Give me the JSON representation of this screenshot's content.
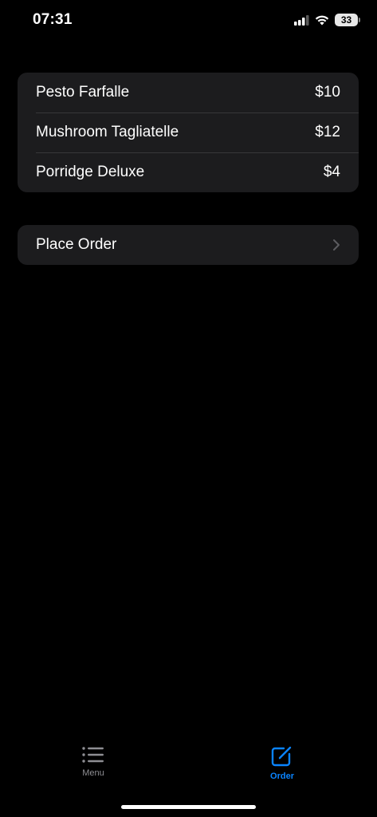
{
  "status_bar": {
    "time": "07:31",
    "battery": "33",
    "icons": [
      "cellular-signal-icon",
      "wifi-icon",
      "battery-icon"
    ]
  },
  "menu": {
    "items": [
      {
        "name": "Pesto Farfalle",
        "price": "$10"
      },
      {
        "name": "Mushroom Tagliatelle",
        "price": "$12"
      },
      {
        "name": "Porridge Deluxe",
        "price": "$4"
      }
    ]
  },
  "actions": {
    "place_order": "Place Order"
  },
  "tab_bar": {
    "tabs": [
      {
        "label": "Menu",
        "icon": "list-icon",
        "selected": false
      },
      {
        "label": "Order",
        "icon": "compose-icon",
        "selected": true
      }
    ]
  },
  "colors": {
    "background": "#000000",
    "card": "#1c1c1e",
    "separator": "#38383a",
    "accent": "#0a84ff",
    "inactive_tab": "#8e8e93"
  }
}
